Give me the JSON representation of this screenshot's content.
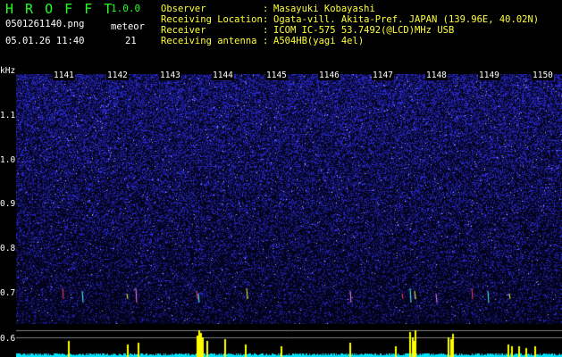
{
  "header": {
    "title": "H R O F F T",
    "version": "1.0.0",
    "file_name": "0501261140.png",
    "timestamp": "05.01.26 11:40",
    "meteor_label": "meteor",
    "meteor_count": "21"
  },
  "info": [
    {
      "key": "Observer",
      "value": "Masayuki Kobayashi"
    },
    {
      "key": "Receiving Location",
      "value": "Ogata-vill. Akita-Pref. JAPAN (139.96E, 40.02N)"
    },
    {
      "key": "Receiver",
      "value": "ICOM IC-575 53.7492(@LCD)MHz USB"
    },
    {
      "key": "Receiving antenna",
      "value": "A504HB(yagi 4el)"
    }
  ],
  "axis": {
    "y_unit": "kHz",
    "y_ticks": [
      "1.1",
      "1.0",
      "0.9",
      "0.8",
      "0.7",
      "0.6"
    ],
    "x_ticks": [
      "1141",
      "1142",
      "1143",
      "1144",
      "1145",
      "1146",
      "1147",
      "1148",
      "1149",
      "1150"
    ]
  },
  "colors": {
    "noise_dot": "#3c3cff",
    "noise_bright": "#b0b0ff",
    "title_green": "#21ff21",
    "info_yellow": "#ffff3a",
    "strip_cyan": "#00e5ff",
    "strip_yellow": "#ffff00"
  }
}
